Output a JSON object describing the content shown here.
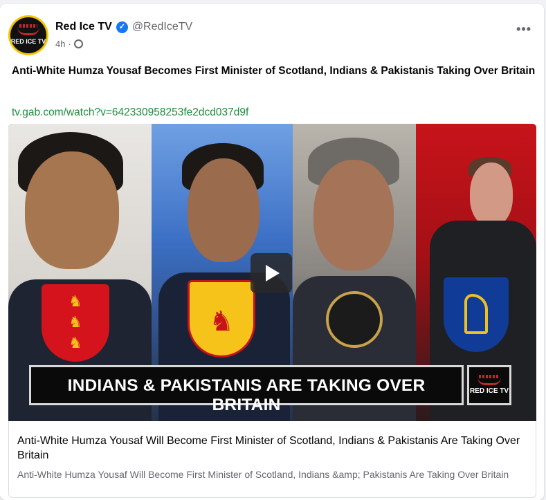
{
  "post": {
    "page_name": "Red Ice TV",
    "handle": "@RedIceTV",
    "time": "4h",
    "separator": "·",
    "more_label": "•••",
    "verified_icon": "✓",
    "avatar_text": "RED ICE TV",
    "title": "Anti-White Humza Yousaf Becomes First Minister of Scotland, Indians & Pakistanis Taking Over Britain",
    "link": "tv.gab.com/watch?v=642330958253fe2dcd037d9f"
  },
  "media": {
    "banner_text": "INDIANS & PAKISTANIS ARE TAKING OVER BRITAIN",
    "logo_text": "RED ICE TV"
  },
  "link_preview": {
    "title": "Anti-White Humza Yousaf Will Become First Minister of Scotland, Indians & Pakistanis Are Taking Over Britain",
    "description": "Anti-White Humza Yousaf Will Become First Minister of Scotland, Indians &amp; Pakistanis Are Taking Over Britain"
  },
  "colors": {
    "verified": "#1877f2",
    "link": "#1f8a3b",
    "brand_red": "#c0282d"
  },
  "icons": [
    "verified-badge-icon",
    "globe-icon",
    "more-options-icon",
    "play-icon"
  ]
}
